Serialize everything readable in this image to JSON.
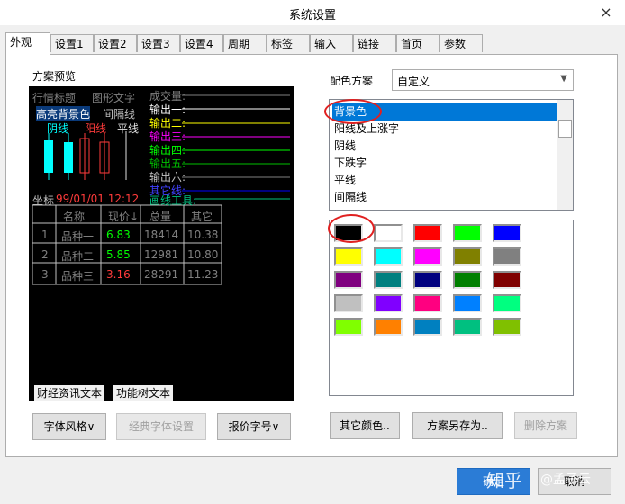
{
  "window": {
    "title": "系统设置",
    "close_icon": "×"
  },
  "tabs": [
    "外观",
    "设置1",
    "设置2",
    "设置3",
    "设置4",
    "周期",
    "标签",
    "输入",
    "链接",
    "首页",
    "参数"
  ],
  "preview": {
    "section_label": "方案预览",
    "header_label1": "行情标题",
    "header_label2": "图形文字",
    "highlight_bg": "高亮背景色",
    "interval_line": "间隔线",
    "yin": "阴线",
    "yang": "阳线",
    "flat": "平线",
    "volume": "成交量:",
    "outputs": [
      "输出一:",
      "输出二:",
      "输出三:",
      "输出四:",
      "输出五:",
      "输出六:",
      "其它线:",
      "画线工具:"
    ],
    "coord_label": "坐标",
    "coord_value": "99/01/01 12:12",
    "table_headers": [
      "名称",
      "现价↓",
      "总量",
      "其它"
    ],
    "table_rows": [
      [
        "1",
        "品种一",
        "6.83",
        "18414",
        "10.38"
      ],
      [
        "2",
        "品种二",
        "5.85",
        "12981",
        "10.80"
      ],
      [
        "3",
        "品种三",
        "3.16",
        "28291",
        "11.23"
      ]
    ],
    "finance_text": "财经资讯文本",
    "function_tree_text": "功能树文本"
  },
  "buttons": {
    "font_style": "字体风格∨",
    "classic_font": "经典字体设置",
    "quote_font": "报价字号∨",
    "other_color": "其它颜色..",
    "save_scheme_as": "方案另存为..",
    "delete_scheme": "删除方案",
    "ok": "确定",
    "cancel": "取消"
  },
  "scheme": {
    "label": "配色方案",
    "value": "自定义",
    "items": [
      "背景色",
      "阳线及上涨字",
      "阴线",
      "下跌字",
      "平线",
      "间隔线"
    ],
    "selected": 0
  },
  "palette": {
    "colors": [
      "#000000",
      "#ffffff",
      "#ff0000",
      "#00ff00",
      "#0000ff",
      "#ffff00",
      "#00ffff",
      "#ff00ff",
      "#808000",
      "#808080",
      "#800080",
      "#008080",
      "#000080",
      "#008000",
      "#800000",
      "#c0c0c0",
      "#8000ff",
      "#ff0080",
      "#0080ff",
      "#00ff80",
      "#80ff00",
      "#ff8000",
      "#0080c0",
      "#00c080",
      "#80c000"
    ],
    "selected": 0
  },
  "watermark": {
    "main": "知乎",
    "user": "@孟子云"
  }
}
